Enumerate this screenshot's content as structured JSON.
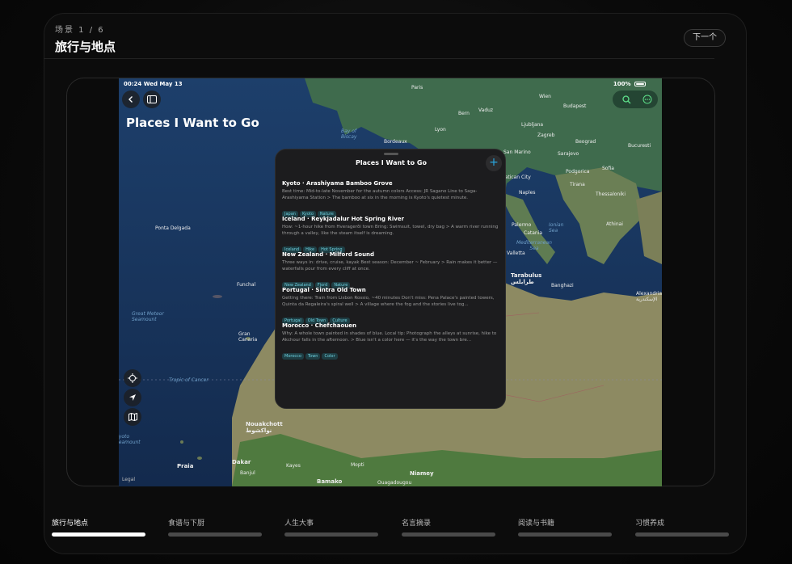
{
  "header": {
    "scene_label": "场景 1 / 6",
    "title": "旅行与地点",
    "next_label": "下一个"
  },
  "device": {
    "status_time": "00:24  Wed May 13",
    "status_battery": "100%",
    "page_title": "Places I Want to Go",
    "icons": {
      "back": "chevron-left-icon",
      "sidebar": "sidebar-icon",
      "search": "search-icon",
      "more": "ellipsis-icon",
      "locate": "crosshair-icon",
      "navigate": "location-arrow-icon",
      "map": "map-icon"
    },
    "map_labels": {
      "paris": "Paris",
      "bern": "Bern",
      "vaduz": "Vaduz",
      "wien": "Wien",
      "budapest": "Budapest",
      "lyon": "Lyon",
      "ljubljana": "Ljubljana",
      "zagreb": "Zagreb",
      "bordeaux": "Bordeaux",
      "beograd": "Beograd",
      "bucuresti": "Bucuresti",
      "sanmarino": "San Marino",
      "sarajevo": "Sarajevo",
      "podgorica": "Podgorica",
      "sofia": "Sofia",
      "vatican": "Vatican City",
      "tirana": "Tirana",
      "naples": "Naples",
      "thessaloniki": "Thessaloniki",
      "palermo": "Palermo",
      "ioniansea": "Ionian\nSea",
      "athinai": "Athinai",
      "catania": "Catania",
      "medsea": "Mediterranean\nSea",
      "valletta": "Valletta",
      "tarabulus": "Tarabulus\nطرابلس",
      "banghazi": "Banghazi",
      "alexandria": "Alexandria\nالإسكندرية",
      "baybiscay": "Bay of\nBiscay",
      "pontadelgada": "Ponta Delgada",
      "funchal": "Funchal",
      "greatmeteor": "Great Meteor\nSeamount",
      "canaria": "Gran\nCanaria",
      "cancer": "Tropic of Cancer",
      "nouakchott": "Nouakchott\nنواكشوط",
      "dakar": "Dakar",
      "banjul": "Banjul",
      "praia": "Praia",
      "bamako": "Bamako",
      "niamey": "Niamey",
      "ouagadougou": "Ouagadougou",
      "kayes": "Kayes",
      "mopti": "Mopti",
      "legal": "Legal",
      "capeverde": "Kyoto\nSeamount"
    }
  },
  "sheet": {
    "title": "Places I Want to Go",
    "add_label": "+",
    "items": [
      {
        "title": "Kyoto · Arashiyama Bamboo Grove",
        "desc": "Best time: Mid-to-late November for the autumn colors Access: JR Sagano Line to Saga-Arashiyama Station > The bamboo at six in the morning is Kyoto's quietest minute.",
        "tags": [
          "Japan",
          "Kyoto",
          "Nature"
        ]
      },
      {
        "title": "Iceland · Reykjadalur Hot Spring River",
        "desc": "How: ~1-hour hike from Hveragerði town Bring: Swimsuit, towel, dry bag > A warm river running through a valley, like the steam itself is dreaming.",
        "tags": [
          "Iceland",
          "Hike",
          "Hot Spring"
        ]
      },
      {
        "title": "New Zealand · Milford Sound",
        "desc": "Three ways in: drive, cruise, kayak Best season: December ~ February > Rain makes it better — waterfalls pour from every cliff at once.",
        "tags": [
          "New Zealand",
          "Fjord",
          "Nature"
        ]
      },
      {
        "title": "Portugal · Sintra Old Town",
        "desc": "Getting there: Train from Lisbon Rossio, ~40 minutes Don't miss: Pena Palace's painted towers, Quinta da Regaleira's spiral well > A village where the fog and the stories live tog...",
        "tags": [
          "Portugal",
          "Old Town",
          "Culture"
        ]
      },
      {
        "title": "Morocco · Chefchaouen",
        "desc": "Why: A whole town painted in shades of blue. Local tip: Photograph the alleys at sunrise, hike to Akchour falls in the afternoon. > Blue isn't a color here — it's the way the town bre...",
        "tags": [
          "Morocco",
          "Town",
          "Color"
        ]
      }
    ]
  },
  "tabs": [
    {
      "label": "旅行与地点",
      "active": true
    },
    {
      "label": "食谱与下厨",
      "active": false
    },
    {
      "label": "人生大事",
      "active": false
    },
    {
      "label": "名言摘录",
      "active": false
    },
    {
      "label": "阅读与书籍",
      "active": false
    },
    {
      "label": "习惯养成",
      "active": false
    }
  ]
}
